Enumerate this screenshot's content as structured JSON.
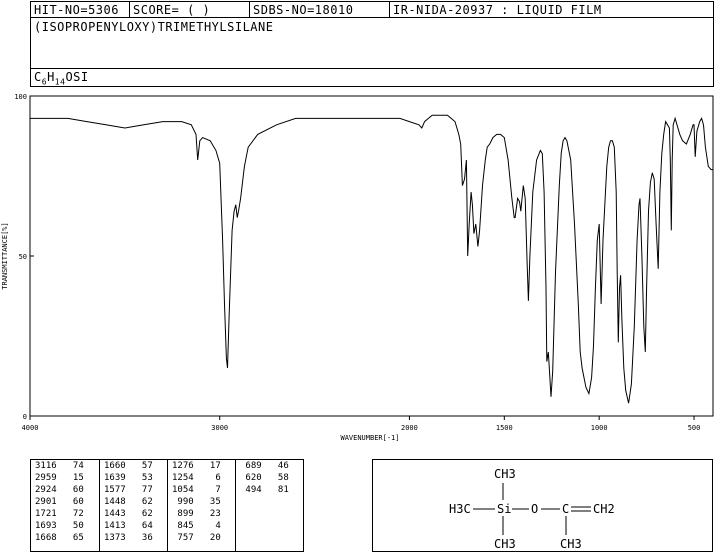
{
  "header": {
    "hit_no": "HIT-NO=5306",
    "score": "SCORE=  (   )",
    "sdbs_no": "SDBS-NO=18010",
    "ir_code": "IR-NIDA-20937 : LIQUID FILM"
  },
  "compound": {
    "name": "(ISOPROPENYLOXY)TRIMETHYLSILANE",
    "formula_c": "C",
    "formula_c_n": "6",
    "formula_h": "H",
    "formula_h_n": "14",
    "formula_rest": "OSI"
  },
  "chart_data": {
    "type": "line",
    "xlabel": "WAVENUMBER[-1]",
    "ylabel": "TRANSMITTANCE[%]",
    "xlim": [
      4000,
      400
    ],
    "ylim": [
      0,
      100
    ],
    "x_ticks": [
      4000,
      3000,
      2000,
      1500,
      1000,
      500
    ],
    "x_tick_labels": [
      "4000",
      "3000",
      "2000",
      "1500",
      "1000",
      "500"
    ],
    "y_ticks": [
      0,
      50,
      100
    ],
    "y_tick_labels": [
      "0",
      "50",
      "100"
    ],
    "spectrum": [
      [
        4000,
        93
      ],
      [
        3900,
        93
      ],
      [
        3800,
        93
      ],
      [
        3700,
        92
      ],
      [
        3600,
        91
      ],
      [
        3500,
        90
      ],
      [
        3400,
        91
      ],
      [
        3300,
        92
      ],
      [
        3200,
        92
      ],
      [
        3150,
        91
      ],
      [
        3125,
        88
      ],
      [
        3116,
        80
      ],
      [
        3105,
        86
      ],
      [
        3090,
        87
      ],
      [
        3050,
        86
      ],
      [
        3020,
        83
      ],
      [
        3000,
        79
      ],
      [
        2985,
        55
      ],
      [
        2975,
        35
      ],
      [
        2965,
        18
      ],
      [
        2959,
        15
      ],
      [
        2950,
        32
      ],
      [
        2935,
        58
      ],
      [
        2924,
        64
      ],
      [
        2915,
        66
      ],
      [
        2908,
        62
      ],
      [
        2901,
        64
      ],
      [
        2890,
        68
      ],
      [
        2870,
        78
      ],
      [
        2850,
        84
      ],
      [
        2800,
        88
      ],
      [
        2700,
        91
      ],
      [
        2600,
        93
      ],
      [
        2500,
        93
      ],
      [
        2400,
        93
      ],
      [
        2300,
        93
      ],
      [
        2200,
        93
      ],
      [
        2100,
        93
      ],
      [
        2050,
        93
      ],
      [
        2000,
        92
      ],
      [
        1950,
        91
      ],
      [
        1935,
        90
      ],
      [
        1920,
        92
      ],
      [
        1900,
        93
      ],
      [
        1880,
        94
      ],
      [
        1860,
        94
      ],
      [
        1840,
        94
      ],
      [
        1820,
        94
      ],
      [
        1800,
        94
      ],
      [
        1780,
        93
      ],
      [
        1760,
        92
      ],
      [
        1740,
        88
      ],
      [
        1730,
        85
      ],
      [
        1721,
        72
      ],
      [
        1710,
        74
      ],
      [
        1700,
        80
      ],
      [
        1693,
        50
      ],
      [
        1685,
        60
      ],
      [
        1675,
        70
      ],
      [
        1668,
        66
      ],
      [
        1660,
        57
      ],
      [
        1650,
        60
      ],
      [
        1639,
        53
      ],
      [
        1630,
        58
      ],
      [
        1615,
        72
      ],
      [
        1600,
        80
      ],
      [
        1590,
        84
      ],
      [
        1577,
        85
      ],
      [
        1560,
        87
      ],
      [
        1540,
        88
      ],
      [
        1520,
        88
      ],
      [
        1500,
        87
      ],
      [
        1480,
        80
      ],
      [
        1460,
        68
      ],
      [
        1448,
        62
      ],
      [
        1443,
        62
      ],
      [
        1430,
        68
      ],
      [
        1420,
        67
      ],
      [
        1413,
        64
      ],
      [
        1400,
        72
      ],
      [
        1390,
        68
      ],
      [
        1380,
        48
      ],
      [
        1373,
        36
      ],
      [
        1365,
        50
      ],
      [
        1350,
        70
      ],
      [
        1330,
        80
      ],
      [
        1310,
        83
      ],
      [
        1300,
        82
      ],
      [
        1290,
        70
      ],
      [
        1280,
        40
      ],
      [
        1276,
        17
      ],
      [
        1268,
        20
      ],
      [
        1262,
        14
      ],
      [
        1254,
        6
      ],
      [
        1245,
        14
      ],
      [
        1230,
        45
      ],
      [
        1210,
        72
      ],
      [
        1200,
        82
      ],
      [
        1190,
        86
      ],
      [
        1180,
        87
      ],
      [
        1170,
        86
      ],
      [
        1150,
        80
      ],
      [
        1130,
        60
      ],
      [
        1110,
        35
      ],
      [
        1100,
        20
      ],
      [
        1090,
        15
      ],
      [
        1080,
        12
      ],
      [
        1070,
        9
      ],
      [
        1054,
        7
      ],
      [
        1040,
        12
      ],
      [
        1030,
        22
      ],
      [
        1020,
        40
      ],
      [
        1010,
        55
      ],
      [
        1000,
        60
      ],
      [
        990,
        35
      ],
      [
        980,
        55
      ],
      [
        960,
        78
      ],
      [
        950,
        84
      ],
      [
        940,
        86
      ],
      [
        930,
        86
      ],
      [
        920,
        84
      ],
      [
        910,
        70
      ],
      [
        905,
        45
      ],
      [
        899,
        23
      ],
      [
        893,
        40
      ],
      [
        887,
        44
      ],
      [
        880,
        30
      ],
      [
        870,
        15
      ],
      [
        860,
        8
      ],
      [
        845,
        4
      ],
      [
        830,
        10
      ],
      [
        815,
        28
      ],
      [
        800,
        55
      ],
      [
        790,
        66
      ],
      [
        785,
        68
      ],
      [
        775,
        50
      ],
      [
        765,
        28
      ],
      [
        757,
        20
      ],
      [
        750,
        40
      ],
      [
        740,
        64
      ],
      [
        730,
        73
      ],
      [
        720,
        76
      ],
      [
        710,
        74
      ],
      [
        700,
        60
      ],
      [
        689,
        46
      ],
      [
        680,
        70
      ],
      [
        670,
        82
      ],
      [
        660,
        88
      ],
      [
        650,
        92
      ],
      [
        640,
        91
      ],
      [
        630,
        90
      ],
      [
        625,
        80
      ],
      [
        620,
        58
      ],
      [
        615,
        80
      ],
      [
        610,
        91
      ],
      [
        600,
        93
      ],
      [
        590,
        91
      ],
      [
        575,
        88
      ],
      [
        560,
        86
      ],
      [
        540,
        85
      ],
      [
        520,
        88
      ],
      [
        505,
        91
      ],
      [
        500,
        91
      ],
      [
        494,
        81
      ],
      [
        485,
        89
      ],
      [
        470,
        92
      ],
      [
        460,
        93
      ],
      [
        450,
        91
      ],
      [
        440,
        84
      ],
      [
        425,
        78
      ],
      [
        410,
        77
      ],
      [
        400,
        77
      ]
    ]
  },
  "peak_table": {
    "columns": [
      [
        [
          "3116",
          "74"
        ],
        [
          "2959",
          "15"
        ],
        [
          "2924",
          "60"
        ],
        [
          "2901",
          "60"
        ],
        [
          "1721",
          "72"
        ],
        [
          "1693",
          "50"
        ],
        [
          "1668",
          "65"
        ]
      ],
      [
        [
          "1660",
          "57"
        ],
        [
          "1639",
          "53"
        ],
        [
          "1577",
          "77"
        ],
        [
          "1448",
          "62"
        ],
        [
          "1443",
          "62"
        ],
        [
          "1413",
          "64"
        ],
        [
          "1373",
          "36"
        ]
      ],
      [
        [
          "1276",
          "17"
        ],
        [
          "1254",
          "6"
        ],
        [
          "1054",
          "7"
        ],
        [
          "990",
          "35"
        ],
        [
          "899",
          "23"
        ],
        [
          "845",
          "4"
        ],
        [
          "757",
          "20"
        ]
      ],
      [
        [
          "689",
          "46"
        ],
        [
          "620",
          "58"
        ],
        [
          "494",
          "81"
        ]
      ]
    ]
  },
  "structure": {
    "top_group": "CH3",
    "left_group": "H3C",
    "si_label": "Si",
    "o_label": "O",
    "c_label": "C",
    "ch2_label": "CH2",
    "bottom_left": "CH3",
    "bottom_right": "CH3"
  }
}
